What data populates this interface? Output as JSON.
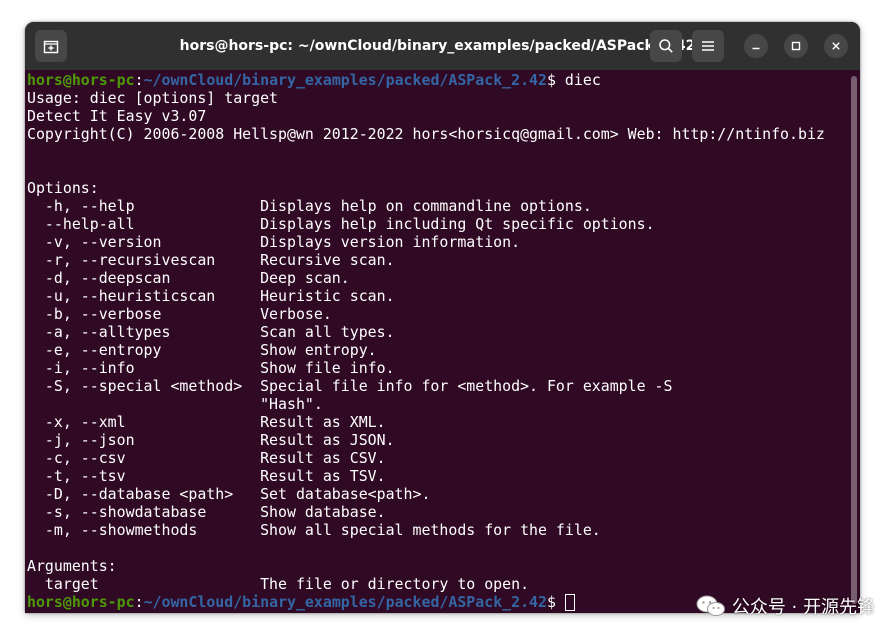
{
  "window": {
    "title": "hors@hors-pc: ~/ownCloud/binary_examples/packed/ASPack_2.42"
  },
  "titlebar": {
    "new_tab_icon": "new-tab-icon",
    "search_icon": "search-icon",
    "menu_icon": "hamburger-menu-icon",
    "minimize_icon": "minimize-icon",
    "maximize_icon": "maximize-icon",
    "close_icon": "close-icon"
  },
  "colors": {
    "terminal_bg": "#300a24",
    "titlebar_bg": "#303030",
    "prompt_user": "#4e9a06",
    "prompt_path": "#3465a4",
    "text": "#ffffff"
  },
  "prompt": {
    "user_host": "hors@hors-pc",
    "separator": ":",
    "path": "~/ownCloud/binary_examples/packed/ASPack_2.42",
    "symbol": "$ "
  },
  "command": "diec",
  "output": [
    "Usage: diec [options] target",
    "Detect It Easy v3.07",
    "Copyright(C) 2006-2008 Hellsp@wn 2012-2022 hors<horsicq@gmail.com> Web: http://ntinfo.biz",
    "",
    "",
    "Options:",
    "  -h, --help              Displays help on commandline options.",
    "  --help-all              Displays help including Qt specific options.",
    "  -v, --version           Displays version information.",
    "  -r, --recursivescan     Recursive scan.",
    "  -d, --deepscan          Deep scan.",
    "  -u, --heuristicscan     Heuristic scan.",
    "  -b, --verbose           Verbose.",
    "  -a, --alltypes          Scan all types.",
    "  -e, --entropy           Show entropy.",
    "  -i, --info              Show file info.",
    "  -S, --special <method>  Special file info for <method>. For example -S",
    "                          \"Hash\".",
    "  -x, --xml               Result as XML.",
    "  -j, --json              Result as JSON.",
    "  -c, --csv               Result as CSV.",
    "  -t, --tsv               Result as TSV.",
    "  -D, --database <path>   Set database<path>.",
    "  -s, --showdatabase      Show database.",
    "  -m, --showmethods       Show all special methods for the file.",
    "",
    "Arguments:",
    "  target                  The file or directory to open."
  ],
  "watermark": {
    "icon": "wechat-official-account-icon",
    "text": "公众号 · 开源先锋"
  }
}
